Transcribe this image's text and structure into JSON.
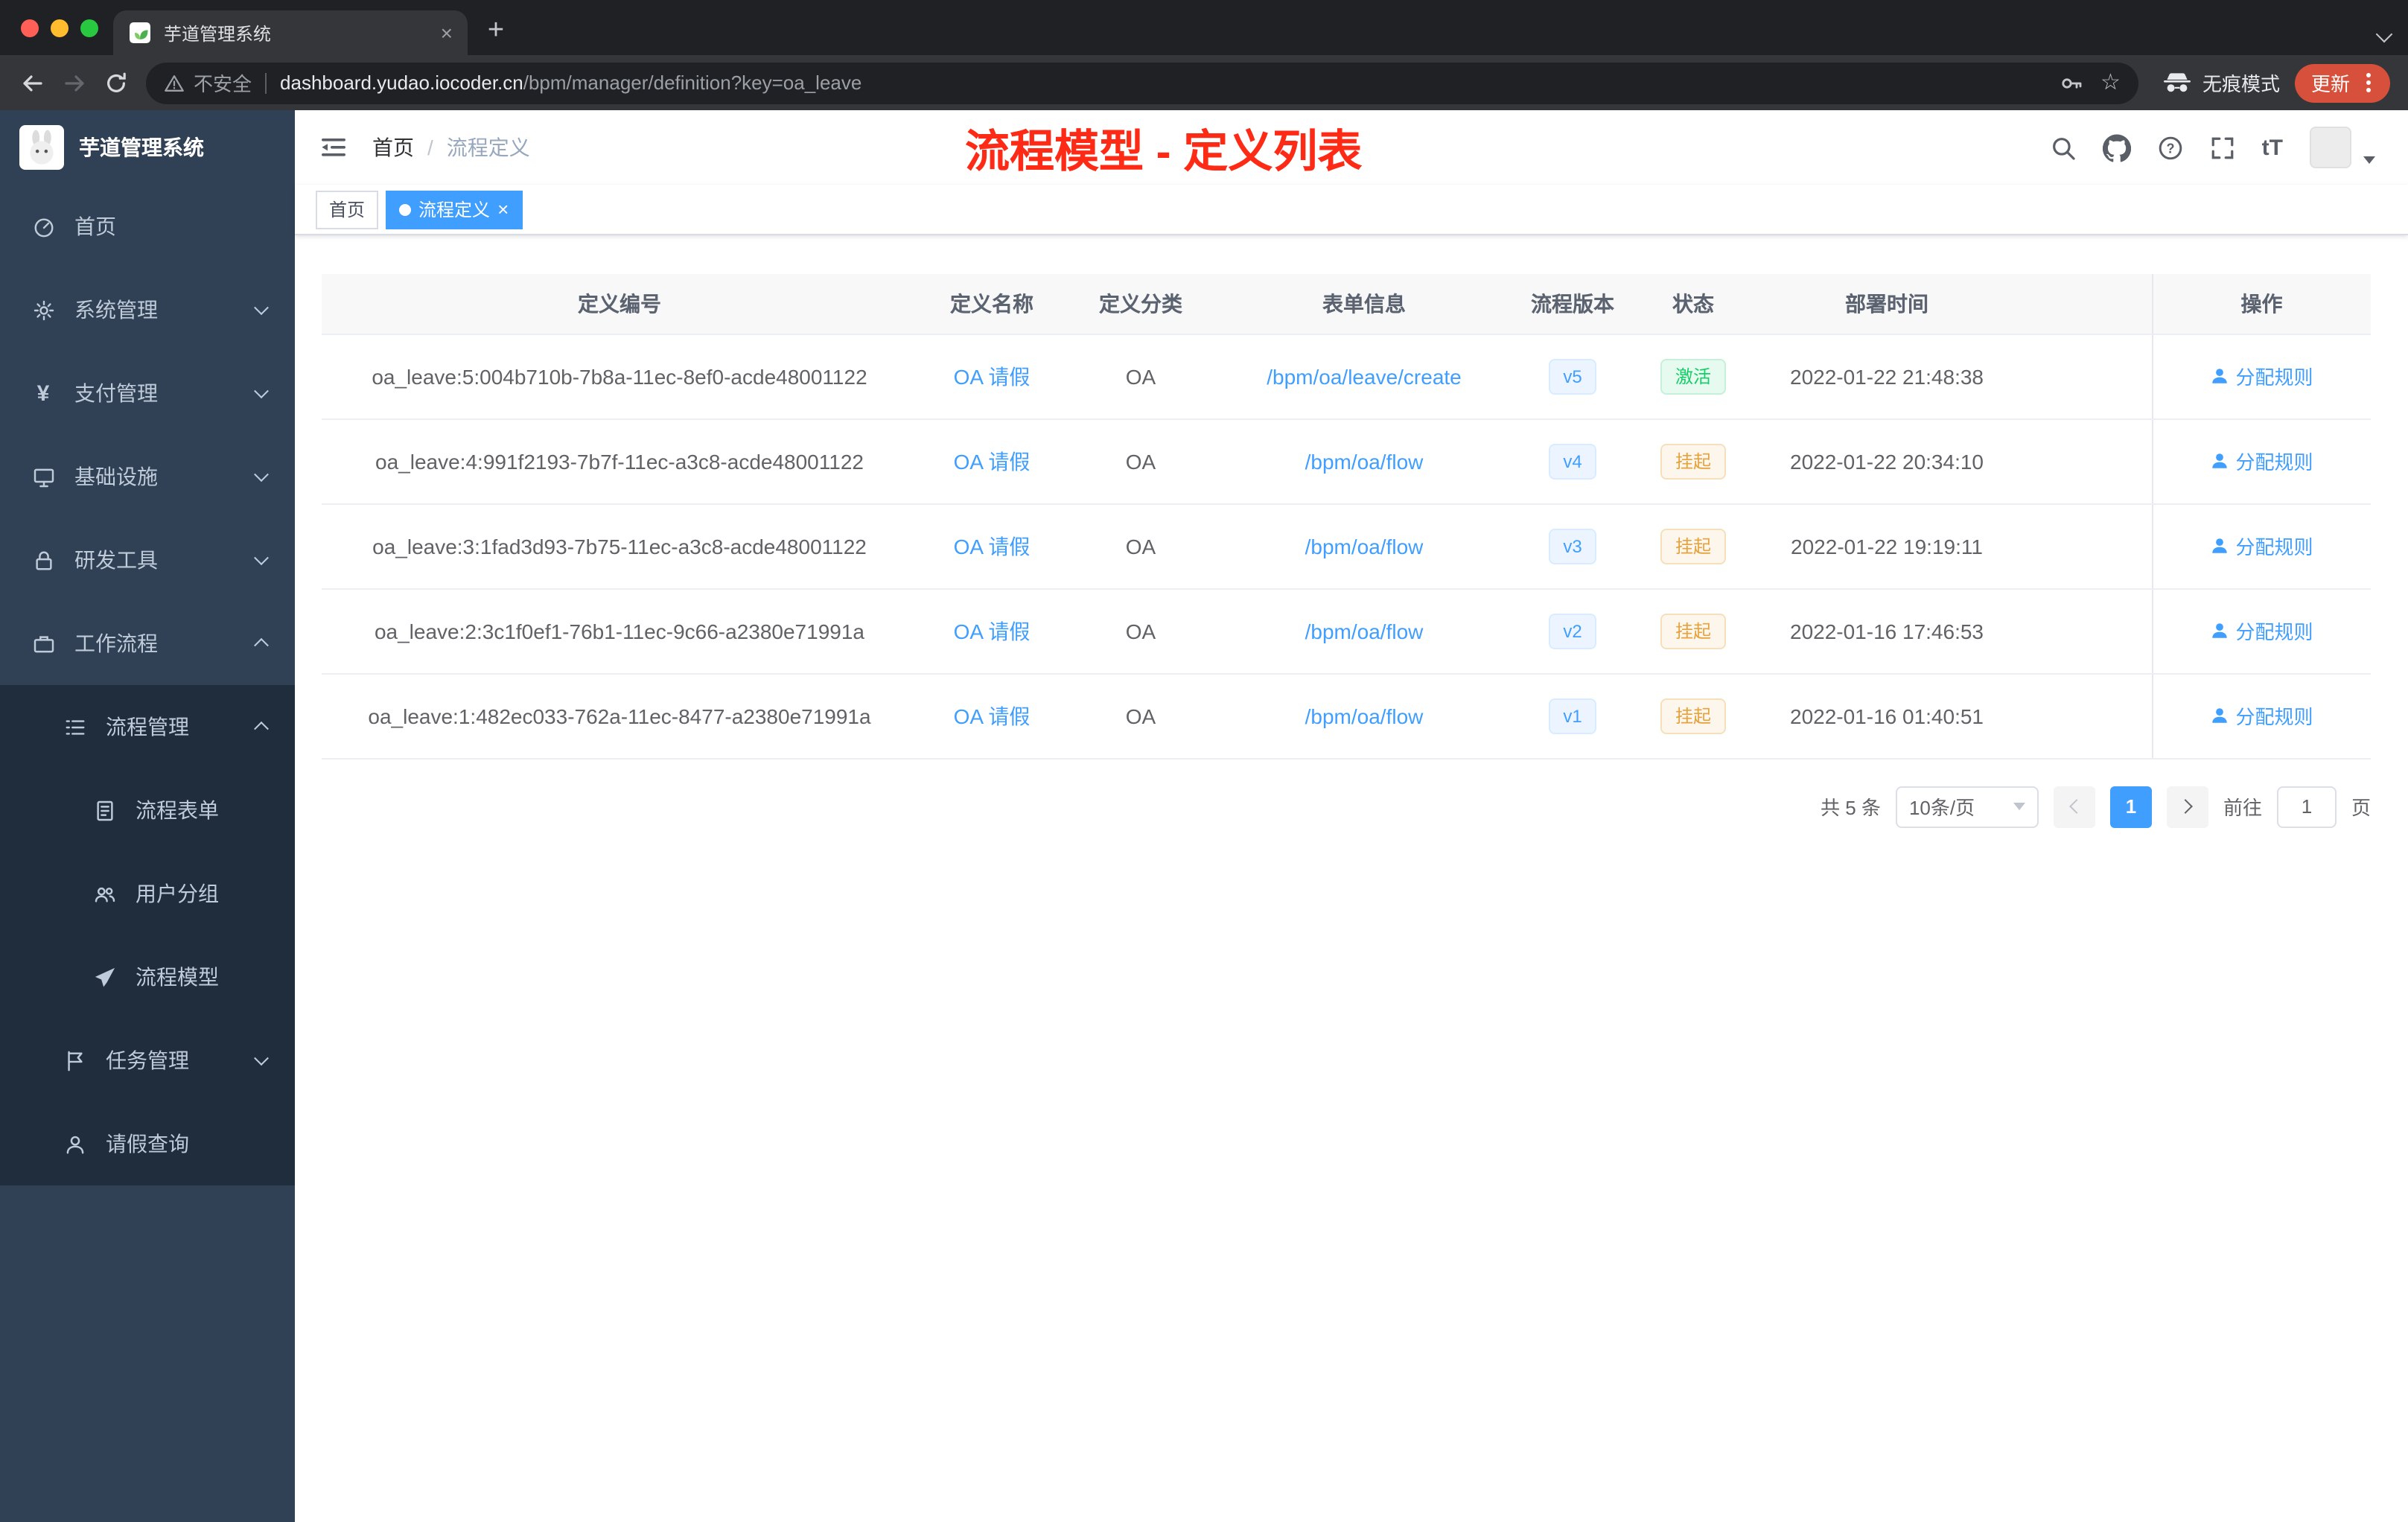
{
  "browser": {
    "tab_title": "芋道管理系统",
    "security_label": "不安全",
    "url_host": "dashboard.yudao.iocoder.cn",
    "url_path": "/bpm/manager/definition?key=oa_leave",
    "incognito_label": "无痕模式",
    "update_label": "更新"
  },
  "sidebar": {
    "logo_title": "芋道管理系统",
    "items": [
      {
        "label": "首页"
      },
      {
        "label": "系统管理"
      },
      {
        "label": "支付管理"
      },
      {
        "label": "基础设施"
      },
      {
        "label": "研发工具"
      },
      {
        "label": "工作流程"
      },
      {
        "label": "流程管理"
      },
      {
        "label": "流程表单"
      },
      {
        "label": "用户分组"
      },
      {
        "label": "流程模型"
      },
      {
        "label": "任务管理"
      },
      {
        "label": "请假查询"
      }
    ]
  },
  "header": {
    "breadcrumb_home": "首页",
    "breadcrumb_separator": "/",
    "breadcrumb_current": "流程定义",
    "annotation": "流程模型 - 定义列表",
    "font_size_icon_label": "tT"
  },
  "tags_view": {
    "home": "首页",
    "active": "流程定义"
  },
  "table": {
    "columns": [
      "定义编号",
      "定义名称",
      "定义分类",
      "表单信息",
      "流程版本",
      "状态",
      "部署时间",
      "操作"
    ],
    "rows": [
      {
        "id": "oa_leave:5:004b710b-7b8a-11ec-8ef0-acde48001122",
        "name": "OA 请假",
        "category": "OA",
        "form": "/bpm/oa/leave/create",
        "version": "v5",
        "status": "激活",
        "status_type": "success",
        "deploy_time": "2022-01-22 21:48:38",
        "action": "分配规则"
      },
      {
        "id": "oa_leave:4:991f2193-7b7f-11ec-a3c8-acde48001122",
        "name": "OA 请假",
        "category": "OA",
        "form": "/bpm/oa/flow",
        "version": "v4",
        "status": "挂起",
        "status_type": "warning",
        "deploy_time": "2022-01-22 20:34:10",
        "action": "分配规则"
      },
      {
        "id": "oa_leave:3:1fad3d93-7b75-11ec-a3c8-acde48001122",
        "name": "OA 请假",
        "category": "OA",
        "form": "/bpm/oa/flow",
        "version": "v3",
        "status": "挂起",
        "status_type": "warning",
        "deploy_time": "2022-01-22 19:19:11",
        "action": "分配规则"
      },
      {
        "id": "oa_leave:2:3c1f0ef1-76b1-11ec-9c66-a2380e71991a",
        "name": "OA 请假",
        "category": "OA",
        "form": "/bpm/oa/flow",
        "version": "v2",
        "status": "挂起",
        "status_type": "warning",
        "deploy_time": "2022-01-16 17:46:53",
        "action": "分配规则"
      },
      {
        "id": "oa_leave:1:482ec033-762a-11ec-8477-a2380e71991a",
        "name": "OA 请假",
        "category": "OA",
        "form": "/bpm/oa/flow",
        "version": "v1",
        "status": "挂起",
        "status_type": "warning",
        "deploy_time": "2022-01-16 01:40:51",
        "action": "分配规则"
      }
    ]
  },
  "pagination": {
    "total_label": "共 5 条",
    "page_size": "10条/页",
    "current_page": "1",
    "goto_label": "前往",
    "goto_value": "1",
    "page_unit": "页"
  },
  "colors": {
    "accent_blue": "#409eff",
    "annotation_red": "#fd2b15",
    "status_active_green": "#13ce66",
    "status_suspend_orange": "#e6a23c",
    "sidebar_bg": "#304156",
    "submenu_bg": "#1f2d3d",
    "update_pill": "#d6503c"
  },
  "icons": {
    "browser": [
      "back-icon",
      "forward-icon",
      "reload-icon",
      "warning-icon",
      "key-icon",
      "star-icon",
      "incognito-icon",
      "more-menu-icon",
      "close-icon",
      "plus-icon",
      "chevron-down-icon"
    ],
    "header": [
      "hamburger-icon",
      "search-icon",
      "github-icon",
      "help-icon",
      "fullscreen-icon",
      "font-size-icon",
      "caret-down-icon"
    ],
    "sidebar": [
      "dashboard-icon",
      "gear-icon",
      "yen-icon",
      "monitor-icon",
      "lock-icon",
      "briefcase-icon",
      "list-icon",
      "form-icon",
      "user-group-icon",
      "paper-plane-icon",
      "flag-icon",
      "person-icon"
    ],
    "table": [
      "user-icon"
    ]
  }
}
